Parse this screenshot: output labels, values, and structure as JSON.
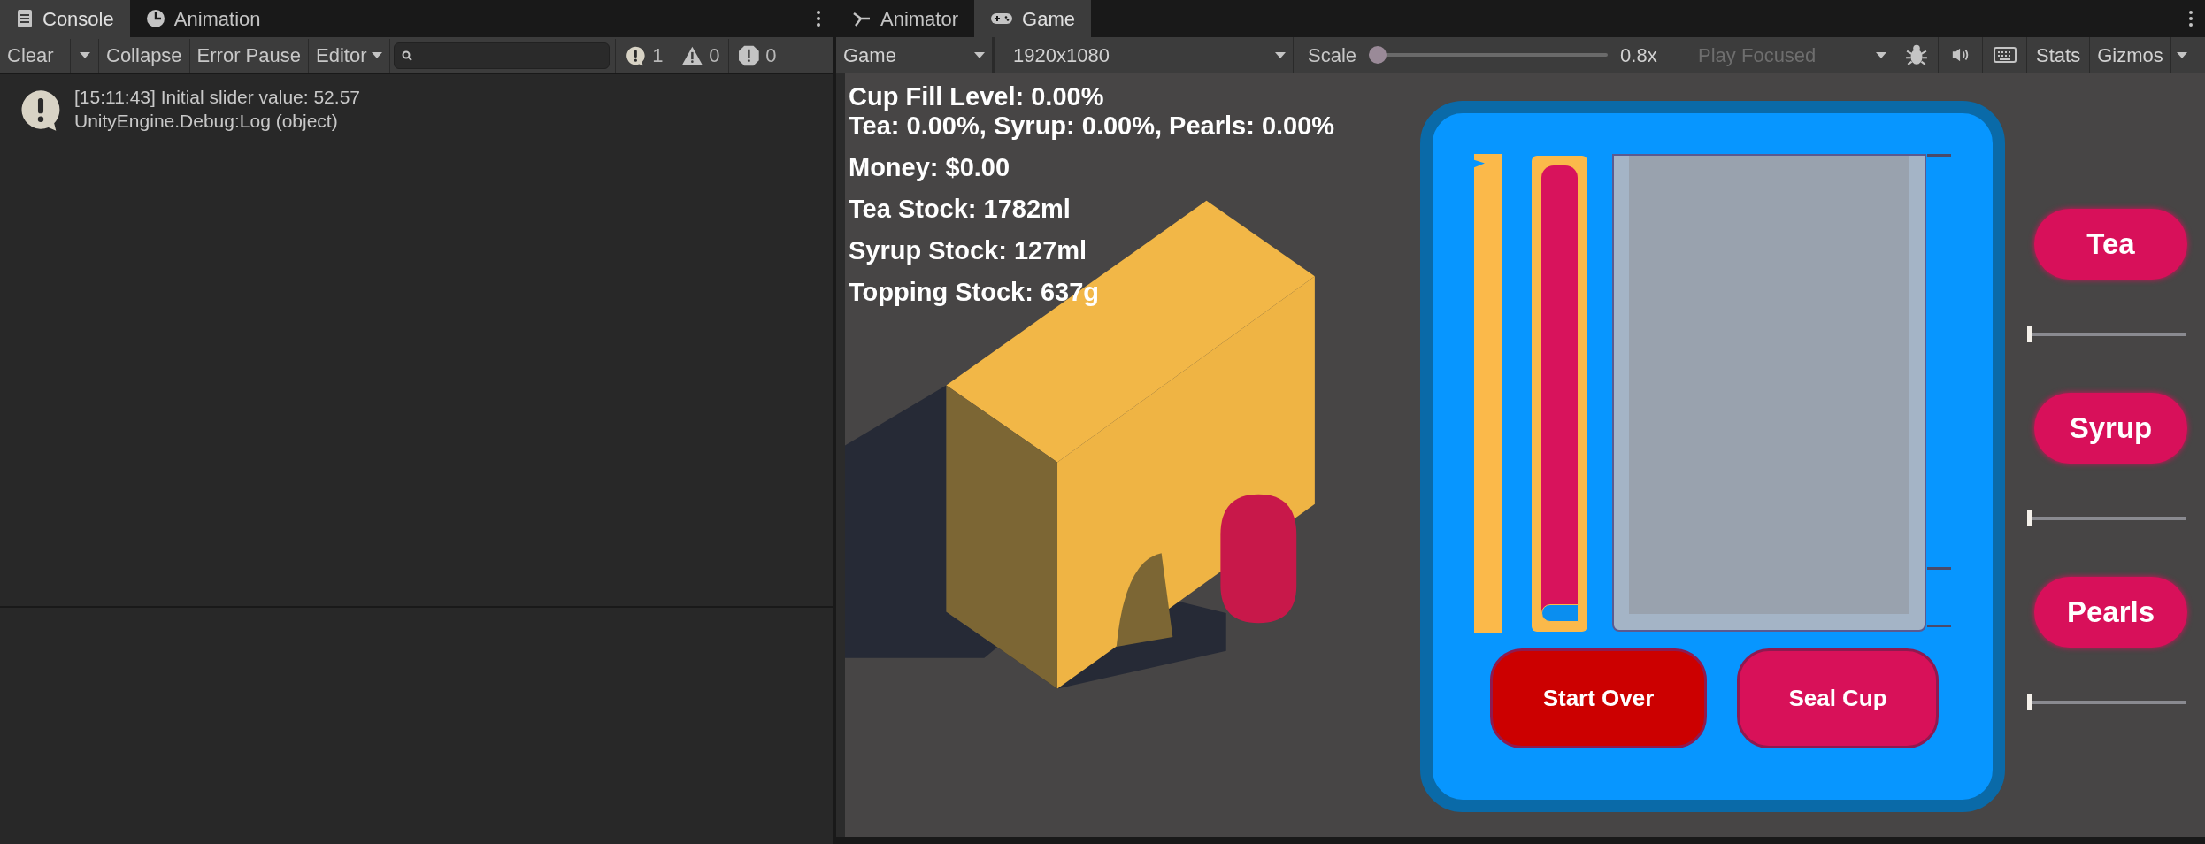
{
  "console": {
    "tabs": [
      {
        "label": "Console",
        "selected": true
      },
      {
        "label": "Animation",
        "selected": false
      }
    ],
    "toolbar": {
      "clear": "Clear",
      "collapse": "Collapse",
      "error_pause": "Error Pause",
      "editor": "Editor",
      "counts": [
        {
          "kind": "info",
          "count": "1"
        },
        {
          "kind": "warning",
          "count": "0"
        },
        {
          "kind": "error",
          "count": "0"
        }
      ]
    },
    "entries": [
      {
        "kind": "info",
        "message": "[15:11:43] Initial slider value: 52.57",
        "source": "UnityEngine.Debug:Log (object)"
      }
    ]
  },
  "game": {
    "tabs": [
      {
        "label": "Animator",
        "selected": false
      },
      {
        "label": "Game",
        "selected": true
      }
    ],
    "toolbar": {
      "display": "Game",
      "resolution": "1920x1080",
      "scale_label": "Scale",
      "scale": {
        "level": 0
      },
      "scale_value": "0.8x",
      "play_mode": "Play Focused",
      "play_mode_disabled": true,
      "stats": "Stats",
      "gizmos": "Gizmos"
    },
    "hud": [
      "Cup Fill Level: 0.00%",
      "Tea: 0.00%, Syrup: 0.00%, Pearls: 0.00%",
      "Money: $0.00",
      "Tea Stock: 1782ml",
      "Syrup Stock: 127ml",
      "Topping Stock: 637g"
    ],
    "cup_panel": {
      "pour_slider": {
        "level": 0
      },
      "buttons": [
        {
          "label": "Start Over",
          "color": "#cc0000"
        },
        {
          "label": "Seal Cup",
          "color": "#d81159"
        }
      ]
    },
    "ingredients": [
      {
        "label": "Tea",
        "level": 0
      },
      {
        "label": "Syrup",
        "level": 0
      },
      {
        "label": "Pearls",
        "level": 0
      }
    ]
  }
}
